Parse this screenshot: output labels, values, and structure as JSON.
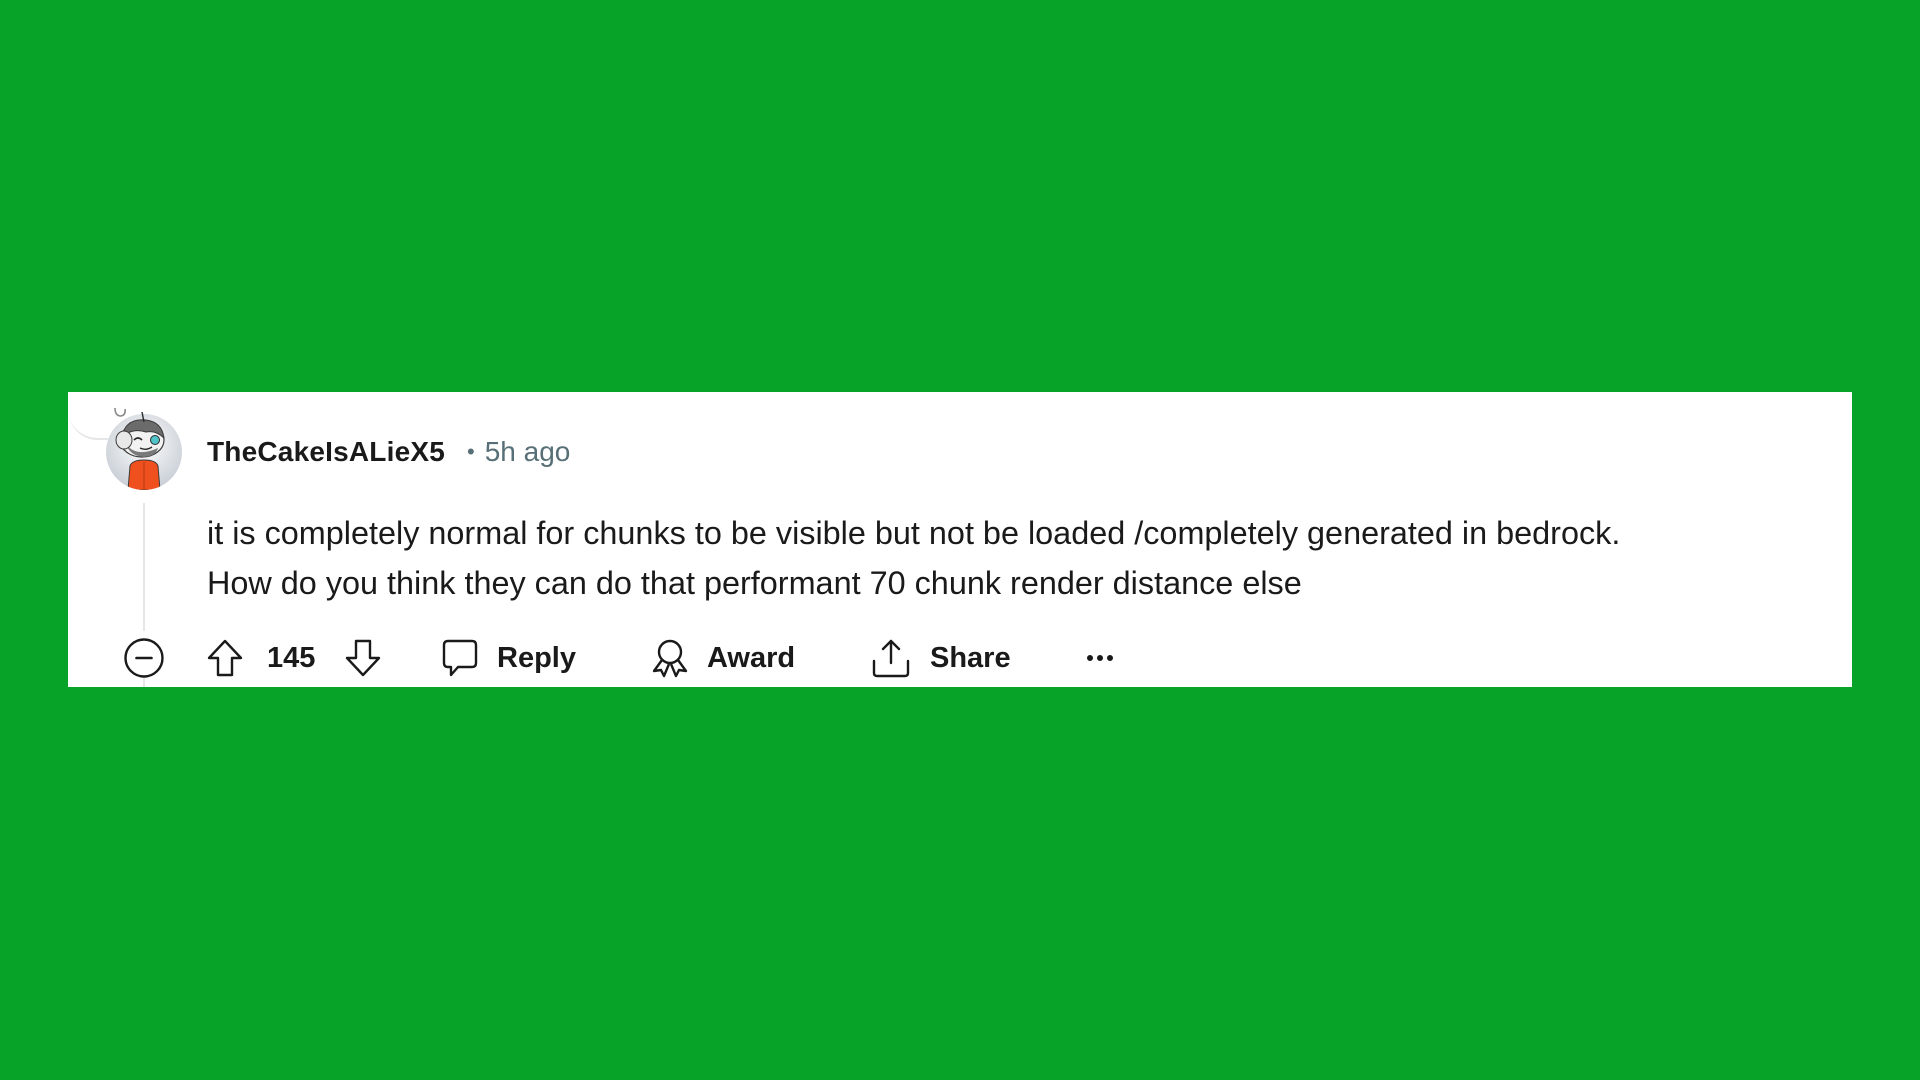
{
  "background_color": "#07a328",
  "comment": {
    "author": "TheCakeIsALieX5",
    "separator": "•",
    "timestamp": "5h ago",
    "body_lines": [
      "it is completely normal for chunks to be visible but not be loaded /completely generated in bedrock.",
      "How do you think they can do that performant 70 chunk render distance else"
    ],
    "avatar": {
      "icon": "snoo-avatar-icon",
      "outfit_color": "#ff4500"
    },
    "score": "145",
    "actions": {
      "collapse_icon": "minus-circle-icon",
      "upvote_icon": "arrow-up-icon",
      "downvote_icon": "arrow-down-icon",
      "reply": {
        "label": "Reply",
        "icon": "speech-bubble-icon"
      },
      "award": {
        "label": "Award",
        "icon": "award-ribbon-icon"
      },
      "share": {
        "label": "Share",
        "icon": "share-upload-icon"
      },
      "more": {
        "label": "•••",
        "icon": "more-horizontal-icon"
      }
    }
  }
}
